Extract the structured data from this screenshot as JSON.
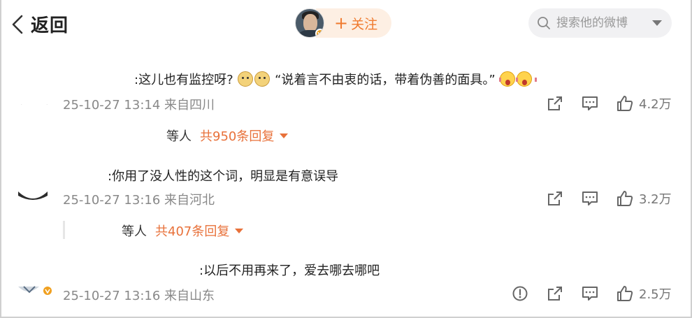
{
  "header": {
    "back_label": "返回",
    "follow_label": "关注",
    "follow_plus": "+",
    "search_placeholder": "搜索他的微博"
  },
  "comments": [
    {
      "text_before": ":这儿也有监控呀?",
      "text_after": "“说着言不由衷的话，带着伪善的面具。”",
      "meta": "25-10-27 13:14 来自四川",
      "likes": "4.2万",
      "reply_who": "等人",
      "reply_more": "共950条回复"
    },
    {
      "text": ":你用了没人性的这个词，明显是有意误导",
      "meta": "25-10-27 13:16 来自河北",
      "likes": "3.2万",
      "reply_who": "等人",
      "reply_more": "共407条回复"
    },
    {
      "text": ":以后不用再来了，爱去哪去哪吧",
      "meta": "25-10-27 13:16 来自山东",
      "likes": "2.5万"
    }
  ],
  "icons": [
    "back-arrow-icon",
    "search-icon",
    "share-icon",
    "comment-icon",
    "like-icon",
    "report-icon",
    "doge-emoji",
    "scream-emoji",
    "verified-badge-icon"
  ],
  "colors": {
    "accent": "#f07a2e",
    "reply_link": "#e8713a",
    "meta_gray": "#888888",
    "search_bg": "#f1f1f3",
    "follow_bg": "#fdefe3"
  }
}
